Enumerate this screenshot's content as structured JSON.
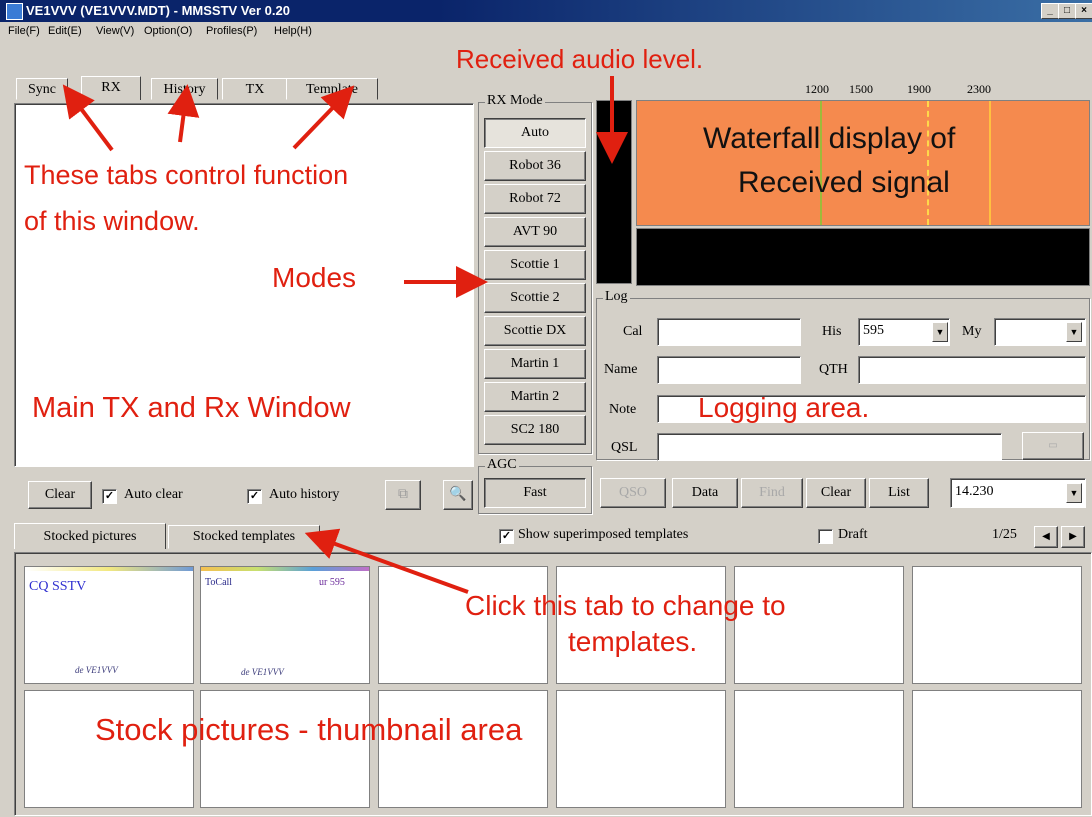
{
  "window": {
    "title": "VE1VVV (VE1VVV.MDT) - MMSSTV Ver 0.20"
  },
  "menu": [
    "File(F)",
    "Edit(E)",
    "View(V)",
    "Option(O)",
    "Profiles(P)",
    "Help(H)"
  ],
  "main_tabs": [
    "Sync",
    "RX",
    "History",
    "TX",
    "Template"
  ],
  "rx_mode": {
    "caption": "RX Mode",
    "modes": [
      "Auto",
      "Robot 36",
      "Robot 72",
      "AVT 90",
      "Scottie 1",
      "Scottie 2",
      "Scottie DX",
      "Martin 1",
      "Martin 2",
      "SC2 180"
    ]
  },
  "agc": {
    "caption": "AGC",
    "value": "Fast"
  },
  "freq_scale": [
    "1200",
    "1500",
    "1900",
    "2300"
  ],
  "log": {
    "caption": "Log",
    "call_label": "Cal",
    "his_label": "His",
    "his_value": "595",
    "my_label": "My",
    "name_label": "Name",
    "qth_label": "QTH",
    "note_label": "Note",
    "qsl_label": "QSL",
    "buttons": [
      "QSO",
      "Data",
      "Find",
      "Clear",
      "List"
    ],
    "frequency": "14.230"
  },
  "rx_controls": {
    "clear": "Clear",
    "auto_clear": "Auto clear",
    "auto_history": "Auto history"
  },
  "stock_tabs": [
    "Stocked pictures",
    "Stocked templates"
  ],
  "superimpose": {
    "show_label": "Show superimposed templates",
    "draft_label": "Draft",
    "page": "1/25"
  },
  "thumbs": [
    {
      "line1": "CQ SSTV",
      "line2": "de VE1VVV"
    },
    {
      "line1": "ToCall",
      "line1b": "ur 595",
      "line2": "de VE1VVV"
    }
  ],
  "annotations": {
    "received_audio": "Received audio level.",
    "waterfall_line1": "Waterfall display of",
    "waterfall_line2": "Received signal",
    "tabs_line1": "These tabs control function",
    "tabs_line2": "of this window.",
    "modes": "Modes",
    "main_window": "Main TX and Rx Window",
    "logging": "Logging area.",
    "click_tab_line1": "Click this tab to change to",
    "click_tab_line2": "templates.",
    "stock_area": "Stock pictures - thumbnail area"
  },
  "colors": {
    "waterfall": "#f58a4e",
    "annotation": "#e02010",
    "titlebar": "#0a246a"
  }
}
